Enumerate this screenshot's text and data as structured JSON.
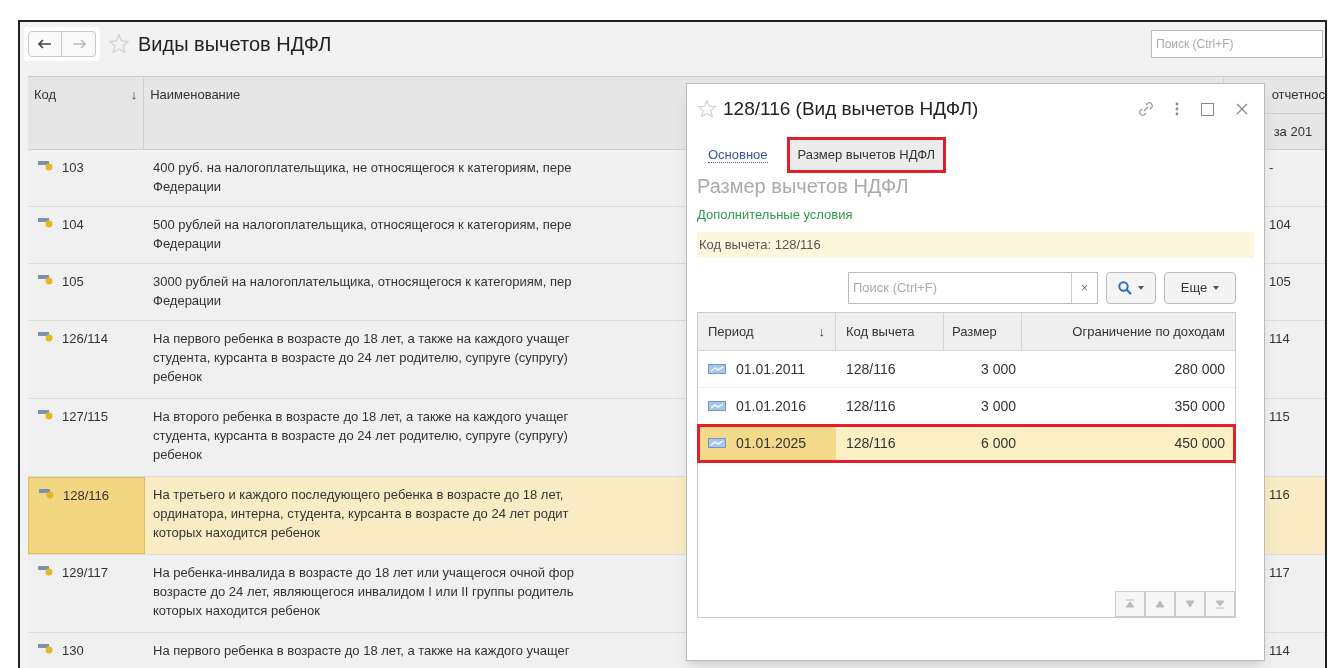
{
  "window": {
    "title": "Виды вычетов НДФЛ",
    "search": {
      "placeholder": "Поиск (Ctrl+F)"
    }
  },
  "table": {
    "columns": [
      {
        "label": "Код",
        "sort": "↓"
      },
      {
        "label": "Наименование"
      },
      {
        "label": "отчетнос",
        "sub": "за 201"
      }
    ],
    "rows": [
      {
        "code": "103",
        "name": "400 руб. на налогоплательщика, не относящегося к категориям, пере\nФедерации",
        "column_3": "-",
        "selected": false
      },
      {
        "code": "104",
        "name": "500 рублей на налогоплательщика, относящегося к категориям, пере\nФедерации",
        "column_3": "104",
        "selected": false
      },
      {
        "code": "105",
        "name": "3000 рублей на налогоплательщика, относящегося к категориям, пер\nФедерации",
        "column_3": "105",
        "selected": false
      },
      {
        "code": "126/114",
        "name": "На первого ребенка в возрасте до 18 лет, а также на каждого учащег\nстудента, курсанта в возрасте до 24 лет родителю, супруге (супругу)\nребенок",
        "column_3": "114",
        "selected": false
      },
      {
        "code": "127/115",
        "name": "На второго ребенка в возрасте до 18 лет, а также на каждого учащег\nстудента, курсанта в возрасте до 24 лет родителю, супруге (супругу)\nребенок",
        "column_3": "115",
        "selected": false
      },
      {
        "code": "128/116",
        "name": "На третьего и каждого последующего ребенка в возрасте до 18 лет,\nординатора, интерна, студента, курсанта в возрасте до 24 лет родит\nкоторых находится ребенок",
        "column_3": "116",
        "selected": true
      },
      {
        "code": "129/117",
        "name": "На ребенка-инвалида в возрасте до 18 лет или учащегося очной фор\nвозрасте до 24 лет, являющегося инвалидом I или II группы родитель\nкоторых находится ребенок",
        "column_3": "117",
        "selected": false
      },
      {
        "code": "130",
        "name": "На первого ребенка в возрасте до 18 лет, а также на каждого учащег",
        "column_3": "114",
        "selected": false
      }
    ]
  },
  "dialog": {
    "title": "128/116 (Вид вычетов НДФЛ)",
    "tabs": [
      {
        "label": "Основное",
        "selected": false,
        "highlight": false
      },
      {
        "label": "Размер вычетов НДФЛ",
        "selected": true,
        "highlight": true
      }
    ],
    "heading": "Размер вычетов НДФЛ",
    "link": "Дополнительные условия",
    "info": "Код вычета: 128/116",
    "search": {
      "placeholder": "Поиск (Ctrl+F)",
      "clear": "×"
    },
    "more_button": "Еще",
    "table": {
      "columns": [
        {
          "label": "Период",
          "sort": "↓"
        },
        {
          "label": "Код вычета"
        },
        {
          "label": "Размер"
        },
        {
          "label": "Ограничение по доходам"
        }
      ],
      "rows": [
        {
          "period": "01.01.2011",
          "code": "128/116",
          "size": "3 000",
          "limit": "280 000",
          "selected": false,
          "highlight": false
        },
        {
          "period": "01.01.2016",
          "code": "128/116",
          "size": "3 000",
          "limit": "350 000",
          "selected": false,
          "highlight": false
        },
        {
          "period": "01.01.2025",
          "code": "128/116",
          "size": "6 000",
          "limit": "450 000",
          "selected": true,
          "highlight": true
        }
      ]
    }
  }
}
